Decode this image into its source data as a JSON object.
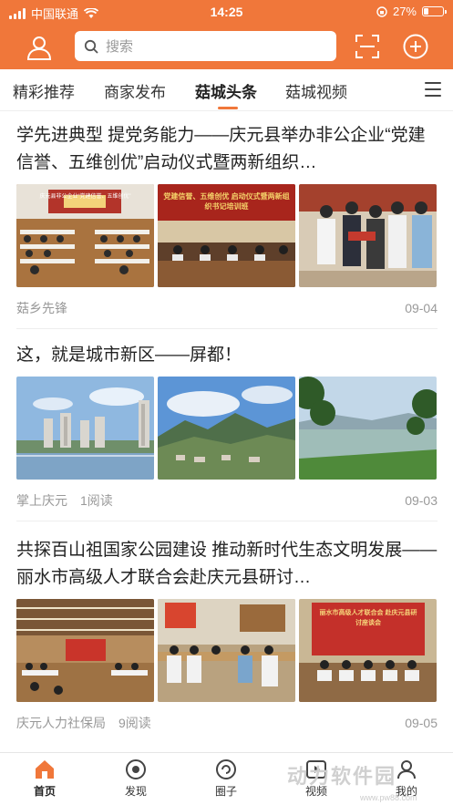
{
  "status_bar": {
    "carrier": "中国联通",
    "time": "14:25",
    "battery": "27%",
    "battery_level": 0.27
  },
  "header": {
    "search_placeholder": "搜索",
    "avatar_icon": "user-icon",
    "scan_icon": "scan-icon",
    "add_icon": "plus-circle-icon"
  },
  "tabs": [
    {
      "label": "精彩推荐",
      "active": false
    },
    {
      "label": "商家发布",
      "active": false
    },
    {
      "label": "菇城头条",
      "active": true
    },
    {
      "label": "菇城视频",
      "active": false
    }
  ],
  "articles": [
    {
      "title": "学先进典型 提党务能力——庆元县举办非公企业“党建信誉、五维创优”启动仪式暨两新组织…",
      "source": "菇乡先锋",
      "reads": "",
      "date": "09-04",
      "images": [
        {
          "banner": "庆元县非公企业“党建信誉、五维创优”"
        },
        {
          "banner": "党建信誉、五维创优 启动仪式暨两新组织书记培训班"
        },
        {
          "banner": ""
        }
      ]
    },
    {
      "title": "这，就是城市新区——屏都！",
      "source": "掌上庆元",
      "reads": "1阅读",
      "date": "09-03",
      "images": [
        {
          "banner": ""
        },
        {
          "banner": ""
        },
        {
          "banner": ""
        }
      ]
    },
    {
      "title": "共探百山祖国家公园建设 推动新时代生态文明发展——丽水市高级人才联合会赴庆元县研讨…",
      "source": "庆元人力社保局",
      "reads": "9阅读",
      "date": "09-05",
      "images": [
        {
          "banner": ""
        },
        {
          "banner": ""
        },
        {
          "banner": "丽水市高级人才联合会 赴庆元县研讨座谈会"
        }
      ]
    }
  ],
  "bottom_nav": [
    {
      "label": "首页",
      "icon": "home-icon",
      "active": true
    },
    {
      "label": "发现",
      "icon": "discover-icon",
      "active": false
    },
    {
      "label": "圈子",
      "icon": "circle-icon",
      "active": false
    },
    {
      "label": "视频",
      "icon": "video-icon",
      "active": false
    },
    {
      "label": "我的",
      "icon": "profile-icon",
      "active": false
    }
  ],
  "watermark": {
    "text": "动力软件园",
    "sub": "www.pw88.com"
  },
  "colors": {
    "accent": "#f0773a",
    "text": "#222222",
    "meta": "#999999"
  }
}
